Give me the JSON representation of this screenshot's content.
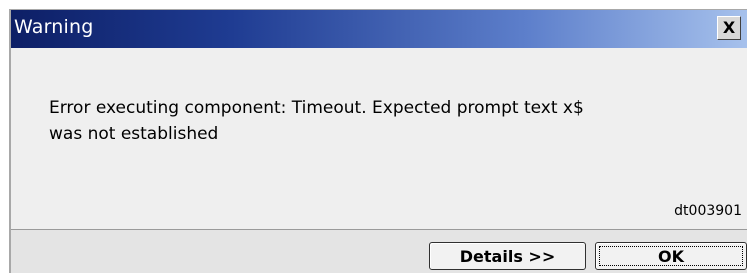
{
  "dialog": {
    "title": "Warning",
    "close_icon_glyph": "X",
    "message": {
      "line1": "Error executing component: Timeout. Expected prompt text x$",
      "line2": "was not established"
    },
    "code": "dt003901",
    "buttons": {
      "details_label": "Details >>",
      "ok_label": "OK"
    }
  },
  "icons": {
    "close": "close-icon"
  },
  "colors": {
    "title_gradient_start": "#0d1f66",
    "title_gradient_end": "#a6c1ec",
    "dialog_background": "#efefef"
  }
}
